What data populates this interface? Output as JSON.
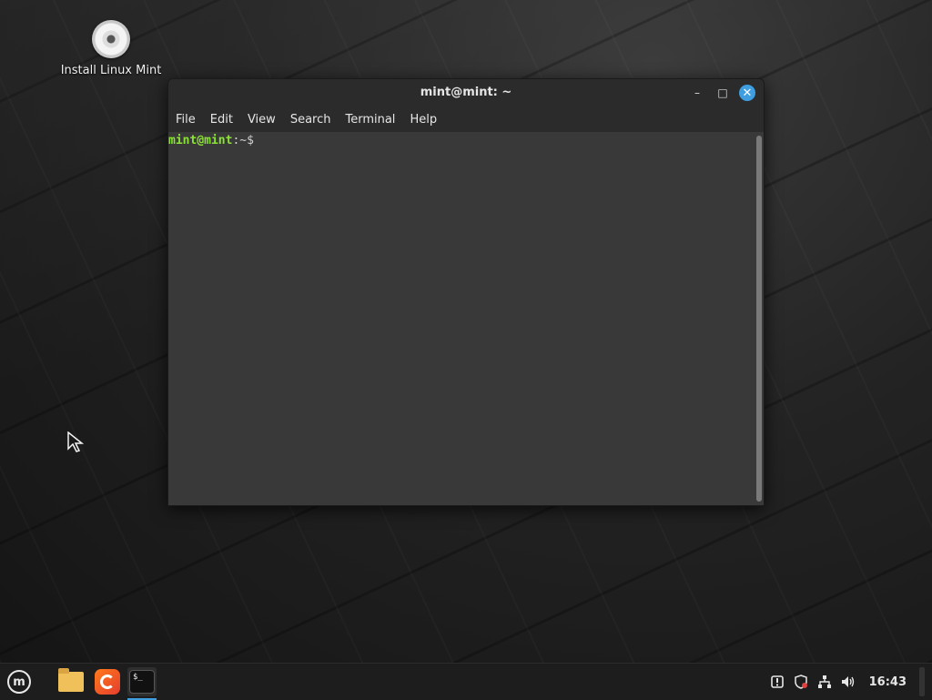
{
  "desktop": {
    "icons": [
      {
        "label": "Install Linux Mint",
        "icon": "disc-icon"
      }
    ]
  },
  "terminal_window": {
    "title": "mint@mint: ~",
    "menu": [
      "File",
      "Edit",
      "View",
      "Search",
      "Terminal",
      "Help"
    ],
    "prompt_user": "mint@mint",
    "prompt_rest": ":~$"
  },
  "panel": {
    "launchers": [
      "menu-icon",
      "folder-icon",
      "firefox-icon",
      "terminal-icon"
    ],
    "tray_icons": [
      "update-manager-icon",
      "shield-icon",
      "network-icon",
      "volume-icon"
    ],
    "clock": "16:43"
  },
  "colors": {
    "prompt_user": "#8ae234",
    "close_button": "#3e9ee0",
    "terminal_bg": "#393939"
  }
}
